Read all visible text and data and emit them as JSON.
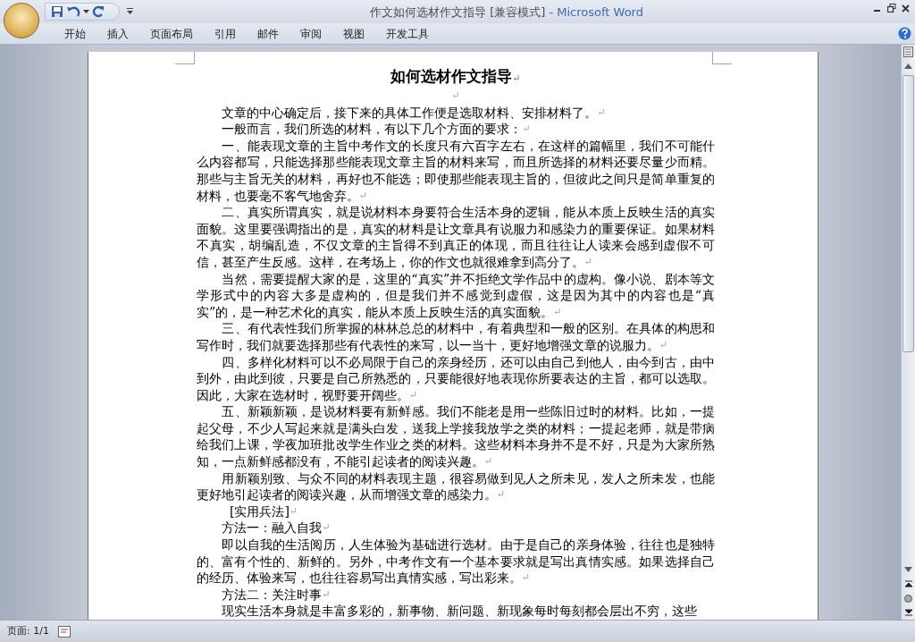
{
  "window": {
    "title": "作文如何选材作文指导 [兼容模式]",
    "app": "- Microsoft Word"
  },
  "ribbon_tabs": [
    {
      "label": "开始"
    },
    {
      "label": "插入"
    },
    {
      "label": "页面布局"
    },
    {
      "label": "引用"
    },
    {
      "label": "邮件"
    },
    {
      "label": "审阅"
    },
    {
      "label": "视图"
    },
    {
      "label": "开发工具"
    }
  ],
  "document": {
    "title": "如何选材作文指导",
    "title_mark": "↵",
    "paragraphs": [
      {
        "kind": "blank",
        "end_mark": "↵"
      },
      {
        "kind": "body",
        "text": "文章的中心确定后，接下来的具体工作便是选取材料、安排材料了。",
        "end_mark": "↵"
      },
      {
        "kind": "body",
        "text": "一般而言，我们所选的材料，有以下几个方面的要求：",
        "end_mark": "↵"
      },
      {
        "kind": "body",
        "text": "一、能表现文章的主旨中考作文的长度只有六百字左右，在这样的篇幅里，我们不可能什么内容都写，只能选择那些能表现文章主旨的材料来写，而且所选择的材料还要尽量少而精。那些与主旨无关的材料，再好也不能选；即使那些能表现主旨的，但彼此之间只是简单重复的材料，也要毫不客气地舍弃。",
        "end_mark": "↵"
      },
      {
        "kind": "body",
        "text": "二、真实所谓真实，就是说材料本身要符合生活本身的逻辑，能从本质上反映生活的真实面貌。这里要强调指出的是，真实的材料是让文章具有说服力和感染力的重要保证。如果材料不真实，胡编乱造，不仅文章的主旨得不到真正的体现，而且往往让人读来会感到虚假不可信，甚至产生反感。这样，在考场上，你的作文也就很难拿到高分了。",
        "end_mark": "↵"
      },
      {
        "kind": "body",
        "text": "当然，需要提醒大家的是，这里的“真实”并不拒绝文学作品中的虚构。像小说、剧本等文学形式中的内容大多是虚构的，但是我们并不感觉到虚假，这是因为其中的内容也是“真实”的，是一种艺术化的真实，能从本质上反映生活的真实面貌。",
        "end_mark": "↵"
      },
      {
        "kind": "body",
        "text": "三、有代表性我们所掌握的林林总总的材料中，有着典型和一般的区别。在具体的构思和写作时，我们就要选择那些有代表性的来写，以一当十，更好地增强文章的说服力。",
        "end_mark": "↵"
      },
      {
        "kind": "body",
        "text": "四、多样化材料可以不必局限于自己的亲身经历，还可以由自己到他人，由今到古，由中到外，由此到彼，只要是自己所熟悉的，只要能很好地表现你所要表达的主旨，都可以选取。因此，大家在选材时，视野要开阔些。",
        "end_mark": "↵"
      },
      {
        "kind": "body",
        "text": "五、新颖新颖，是说材料要有新鲜感。我们不能老是用一些陈旧过时的材料。比如，一提起父母，不少人写起来就是满头白发，送我上学接我放学之类的材料；一提起老师，就是带病给我们上课，学夜加班批改学生作业之类的材料。这些材料本身并不是不好，只是为大家所熟知，一点新鲜感都没有，不能引起读者的阅读兴趣。",
        "end_mark": "↵"
      },
      {
        "kind": "body",
        "text": "用新颖别致、与众不同的材料表现主题，很容易做到见人之所未见，发人之所未发，也能更好地引起读者的阅读兴趣，从而增强文章的感染力。",
        "end_mark": "↵"
      },
      {
        "kind": "heading",
        "text": "[实用兵法]",
        "end_mark": "↵"
      },
      {
        "kind": "body",
        "text": "方法一：融入自我",
        "end_mark": "↵"
      },
      {
        "kind": "body",
        "text": "即以自我的生活阅历，人生体验为基础进行选材。由于是自己的亲身体验，往往也是独特的、富有个性的、新鲜的。另外，中考作文有一个基本要求就是写出真情实感。如果选择自己的经历、体验来写，也往往容易写出真情实感，写出彩来。",
        "end_mark": "↵"
      },
      {
        "kind": "body",
        "text": "方法二：关注时事",
        "end_mark": "↵"
      },
      {
        "kind": "body",
        "text": "现实生活本身就是丰富多彩的，新事物、新问题、新现象每时每刻都会层出不穷，这些"
      }
    ]
  },
  "status_bar": {
    "page": "页面: 1/1"
  }
}
